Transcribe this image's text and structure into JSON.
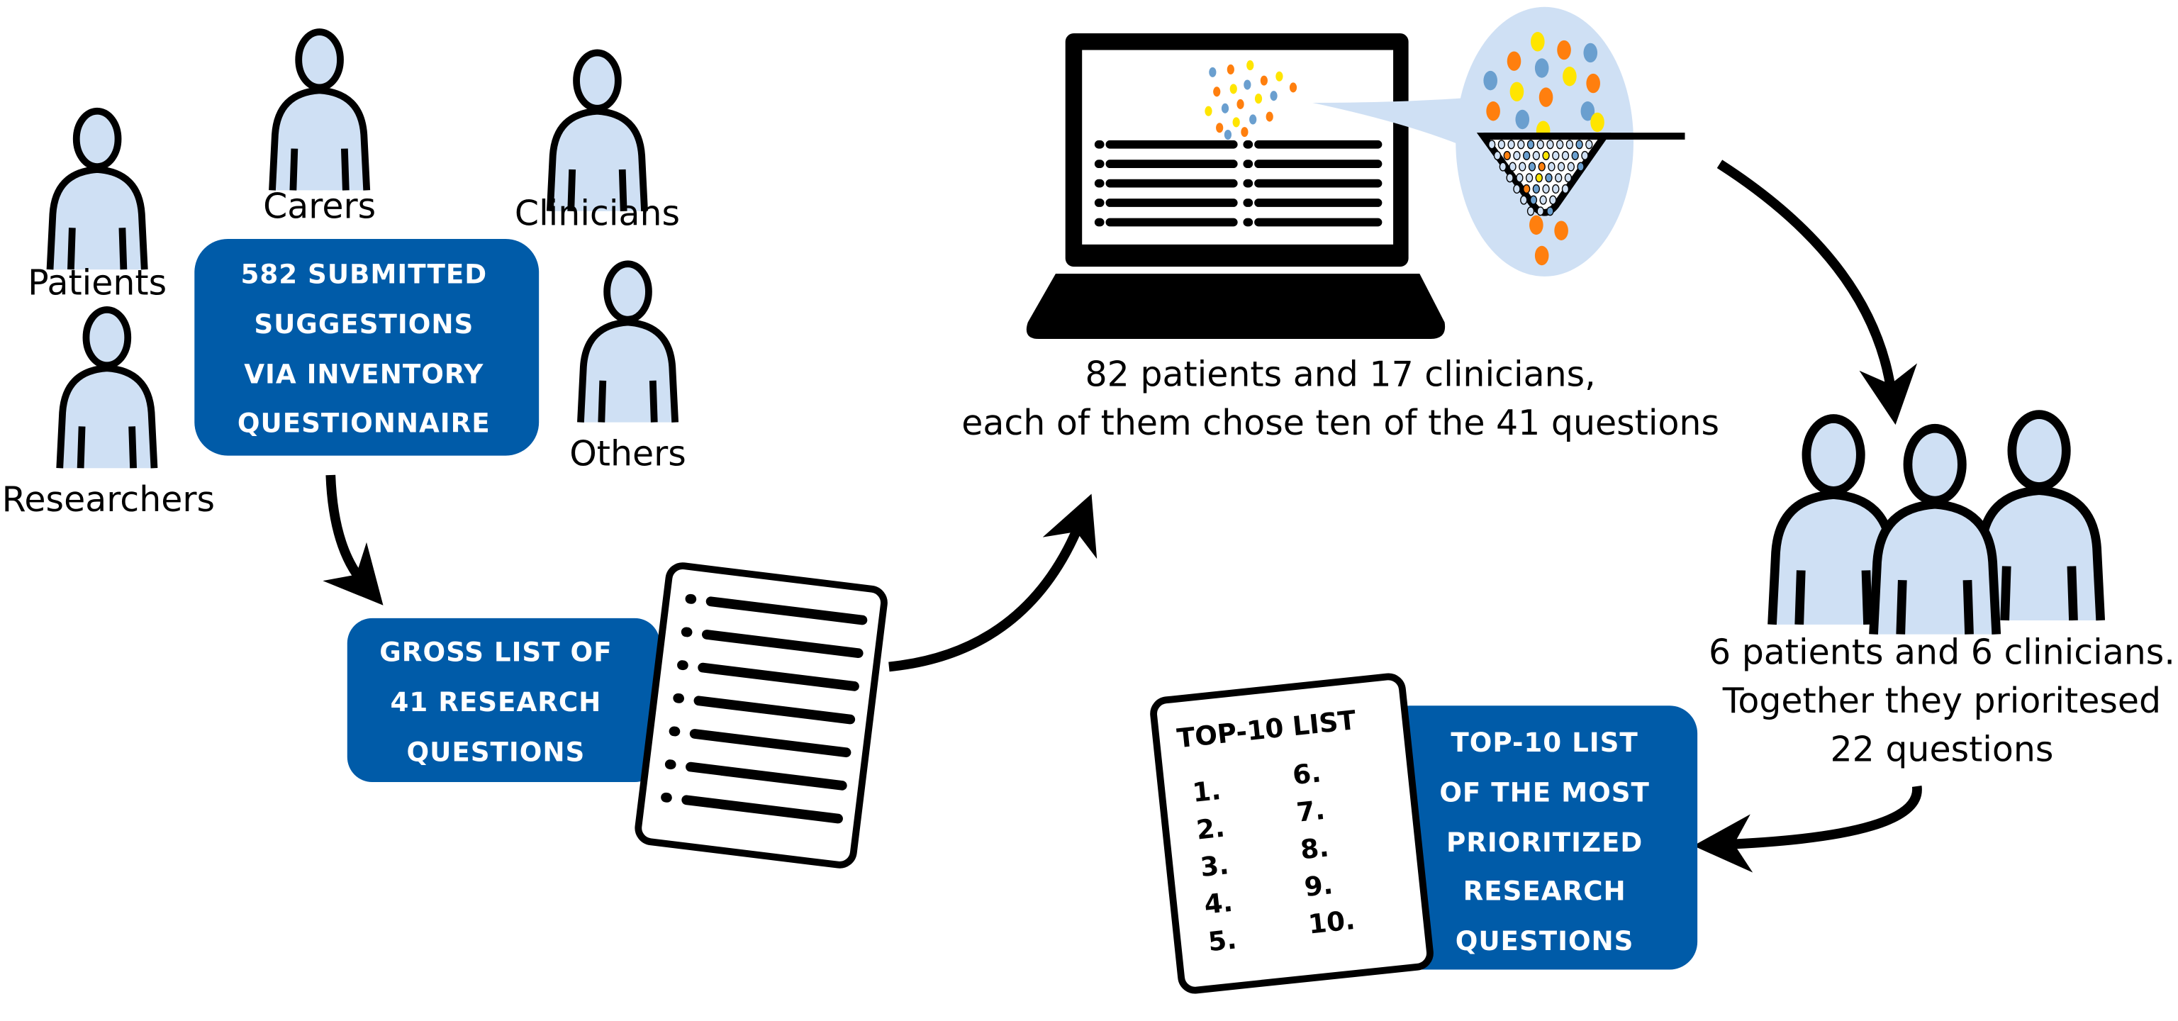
{
  "colors": {
    "box_blue": "#005BA8",
    "light_blue": "#CFE0F4",
    "orange": "#FF7F0E",
    "yellow": "#FFE500",
    "dot_blue": "#6A9FCF"
  },
  "stakeholders": {
    "patients": "Patients",
    "carers": "Carers",
    "clinicians": "Clinicians",
    "researchers": "Researchers",
    "others": "Others"
  },
  "submitted_box": {
    "lines": [
      "582 SUBMITTED",
      "SUGGESTIONS",
      "VIA INVENTORY",
      "QUESTIONNAIRE"
    ]
  },
  "gross_list_box": {
    "lines": [
      "GROSS LIST OF",
      "41 RESEARCH",
      "QUESTIONS"
    ]
  },
  "survey_text": {
    "lines": [
      "82 patients and 17 clinicians,",
      "each of them chose ten of the 41 questions"
    ]
  },
  "workshop_text": {
    "lines": [
      "6 patients and 6 clinicians.",
      "Together they prioritesed",
      "22 questions"
    ]
  },
  "top10_doc": {
    "title": "TOP-10 LIST",
    "numbers": [
      "1.",
      "2.",
      "3.",
      "4.",
      "5.",
      "6.",
      "7.",
      "8.",
      "9.",
      "10."
    ]
  },
  "top10_box": {
    "lines": [
      "TOP-10 LIST",
      "OF THE MOST",
      "PRIORITIZED",
      "RESEARCH",
      "QUESTIONS"
    ]
  }
}
